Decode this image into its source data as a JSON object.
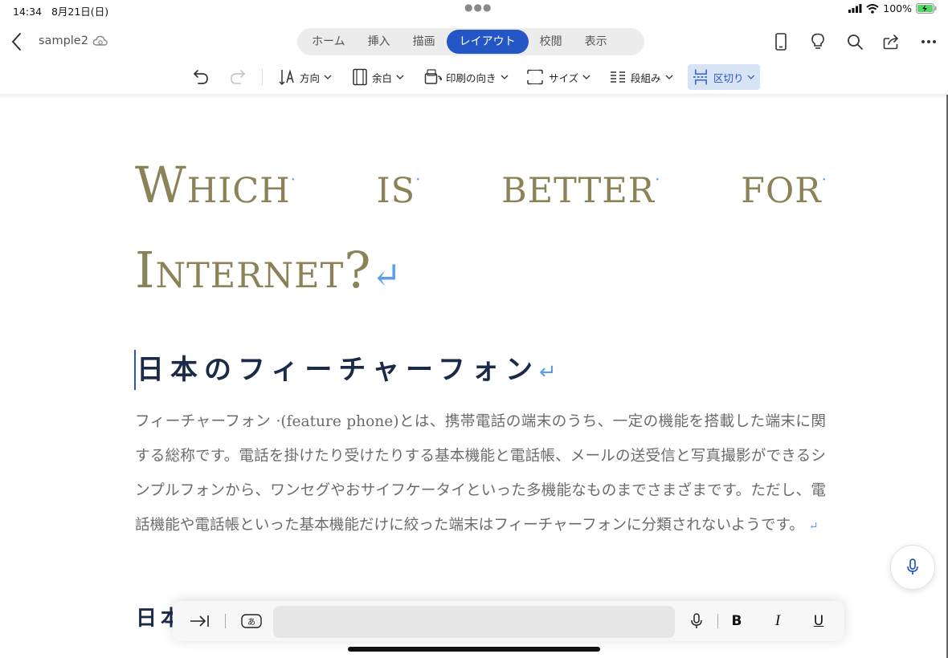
{
  "status_bar": {
    "time": "14:34",
    "date": "8月21日(日)",
    "battery_percent": "100%"
  },
  "header": {
    "doc_name": "sample2",
    "tabs": [
      {
        "label": "ホーム"
      },
      {
        "label": "挿入"
      },
      {
        "label": "描画"
      },
      {
        "label": "レイアウト"
      },
      {
        "label": "校閲"
      },
      {
        "label": "表示"
      }
    ],
    "active_tab": "レイアウト"
  },
  "ribbon": {
    "direction": "方向",
    "margins": "余白",
    "orientation": "印刷の向き",
    "size": "サイズ",
    "columns": "段組み",
    "breaks": "区切り"
  },
  "document": {
    "title_words": [
      "Which",
      "is",
      "better",
      "for",
      "Internet?"
    ],
    "heading1": "日本のフィーチャーフォン",
    "paragraph": "フィーチャーフォン ·(feature phone)とは、携帯電話の端末のうち、一定の機能を搭載した端末に関する総称です。電話を掛けたり受けたりする基本機能と電話帳、メールの送受信と写真撮影ができるシンプルフォンから、ワンセグやおサイフケータイといった多機能なものまでさまざまです。ただし、電話機能や電話帳といった基本機能だけに絞った端末はフィーチャーフォンに分類されないようです。",
    "heading2_partial": "日本"
  },
  "keyboard_bar": {
    "bold": "B",
    "italic": "I",
    "underline": "U"
  },
  "colors": {
    "accent": "#2457c5",
    "title": "#8c8258",
    "heading": "#1b2a48",
    "body_text": "#6b6b6b",
    "formatting_marks": "#5b9ef0"
  }
}
